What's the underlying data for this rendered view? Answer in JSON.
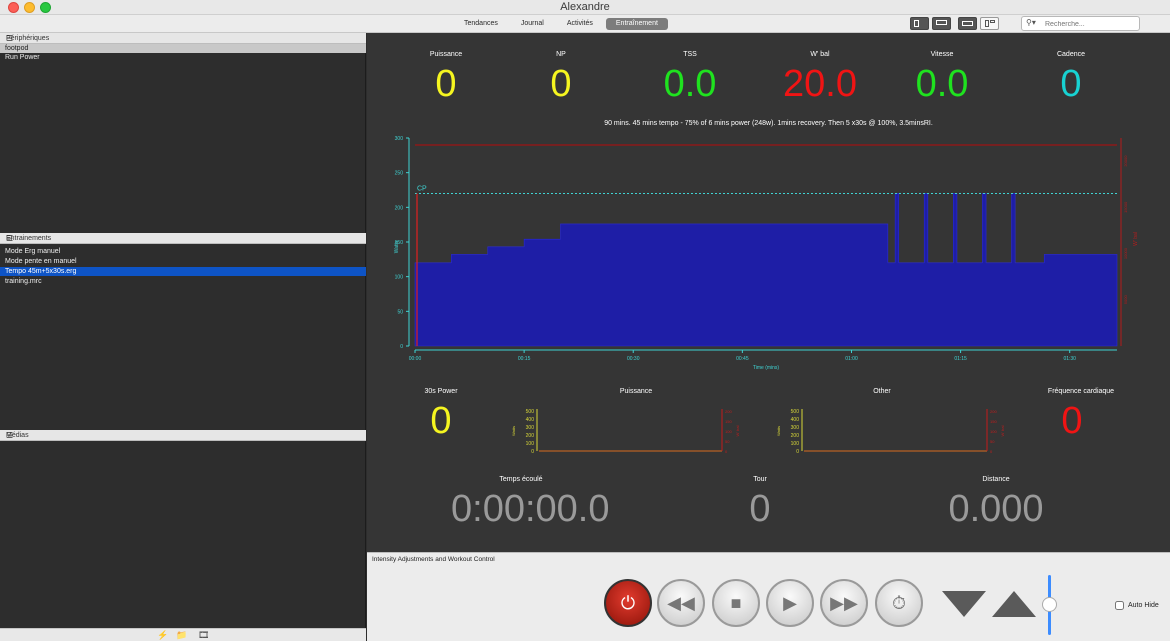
{
  "window": {
    "title": "Alexandre"
  },
  "toolbar": {
    "tabs": [
      "Tendances",
      "Journal",
      "Activités",
      "Entraînement"
    ],
    "active_tab": 3,
    "search_placeholder": "Recherche..."
  },
  "sidebar": {
    "devices": {
      "title": "Périphériques",
      "items": [
        "footpod",
        "Run Power"
      ]
    },
    "workouts": {
      "title": "Entrainements",
      "items": [
        "Mode Erg manuel",
        "Mode pente en manuel",
        "Tempo 45m+5x30s.erg",
        "training.mrc"
      ]
    },
    "media": {
      "title": "Médias"
    }
  },
  "metrics_top": [
    {
      "label": "Puissance",
      "value": "0",
      "color": "#f5f520"
    },
    {
      "label": "NP",
      "value": "0",
      "color": "#f5f520"
    },
    {
      "label": "TSS",
      "value": "0.0",
      "color": "#1fe21f"
    },
    {
      "label": "W' bal",
      "value": "20.0",
      "color": "#f01414"
    },
    {
      "label": "Vitesse",
      "value": "0.0",
      "color": "#1fe21f"
    },
    {
      "label": "Cadence",
      "value": "0",
      "color": "#18d2d2"
    }
  ],
  "workout_description": "90 mins. 45 mins tempo - 75% of 6 mins power (248w). 1mins recovery. Then 5 x30s @ 100%, 3.5minsRI.",
  "chart_data": {
    "type": "area",
    "xlabel": "Time (mins)",
    "ylabel": "Watts",
    "x_ticks": [
      "00:00",
      "00:15",
      "00:30",
      "00:45",
      "01:00",
      "01:15",
      "01:30"
    ],
    "y_ticks": [
      0,
      50,
      100,
      150,
      200,
      250,
      300
    ],
    "ylim": [
      0,
      300
    ],
    "xlim": [
      0,
      96.5
    ],
    "cp_label": "CP",
    "cp_value": 220,
    "wbal_ylabel": "W' bal",
    "workout_profile": [
      [
        0,
        120
      ],
      [
        5,
        120
      ],
      [
        5,
        132
      ],
      [
        10,
        132
      ],
      [
        10,
        143
      ],
      [
        15,
        143
      ],
      [
        15,
        154
      ],
      [
        20,
        154
      ],
      [
        20,
        176
      ],
      [
        65,
        176
      ],
      [
        65,
        120
      ],
      [
        66,
        120
      ],
      [
        66,
        220
      ],
      [
        66.5,
        220
      ],
      [
        66.5,
        120
      ],
      [
        70,
        120
      ],
      [
        70,
        220
      ],
      [
        70.5,
        220
      ],
      [
        70.5,
        120
      ],
      [
        74,
        120
      ],
      [
        74,
        220
      ],
      [
        74.5,
        220
      ],
      [
        74.5,
        120
      ],
      [
        78,
        120
      ],
      [
        78,
        220
      ],
      [
        78.5,
        220
      ],
      [
        78.5,
        120
      ],
      [
        82,
        120
      ],
      [
        82,
        220
      ],
      [
        82.5,
        220
      ],
      [
        82.5,
        120
      ],
      [
        86.5,
        120
      ],
      [
        86.5,
        132
      ],
      [
        96.5,
        132
      ]
    ],
    "wbal_ticks": [
      "5000",
      "10000",
      "15000",
      "20000"
    ]
  },
  "metrics_mid": {
    "power30_label": "30s Power",
    "power30_value": "0",
    "puissance_label": "Puissance",
    "other_label": "Other",
    "hr_label": "Fréquence cardiaque",
    "hr_value": "0",
    "mini_y_left": [
      "500",
      "400",
      "300",
      "200",
      "100",
      "0"
    ],
    "mini_y_right": [
      "200",
      "150",
      "100",
      "50",
      "0"
    ],
    "mini_ylabel": "Watts",
    "mini_rlabel": "W' bal"
  },
  "metrics_bottom": [
    {
      "label": "Temps écoulé",
      "value": "0:00:00.0"
    },
    {
      "label": "Tour",
      "value": "0"
    },
    {
      "label": "Distance",
      "value": "0.000"
    }
  ],
  "controls": {
    "title": "Intensity Adjustments and Workout Control",
    "auto_hide_label": "Auto Hide"
  }
}
